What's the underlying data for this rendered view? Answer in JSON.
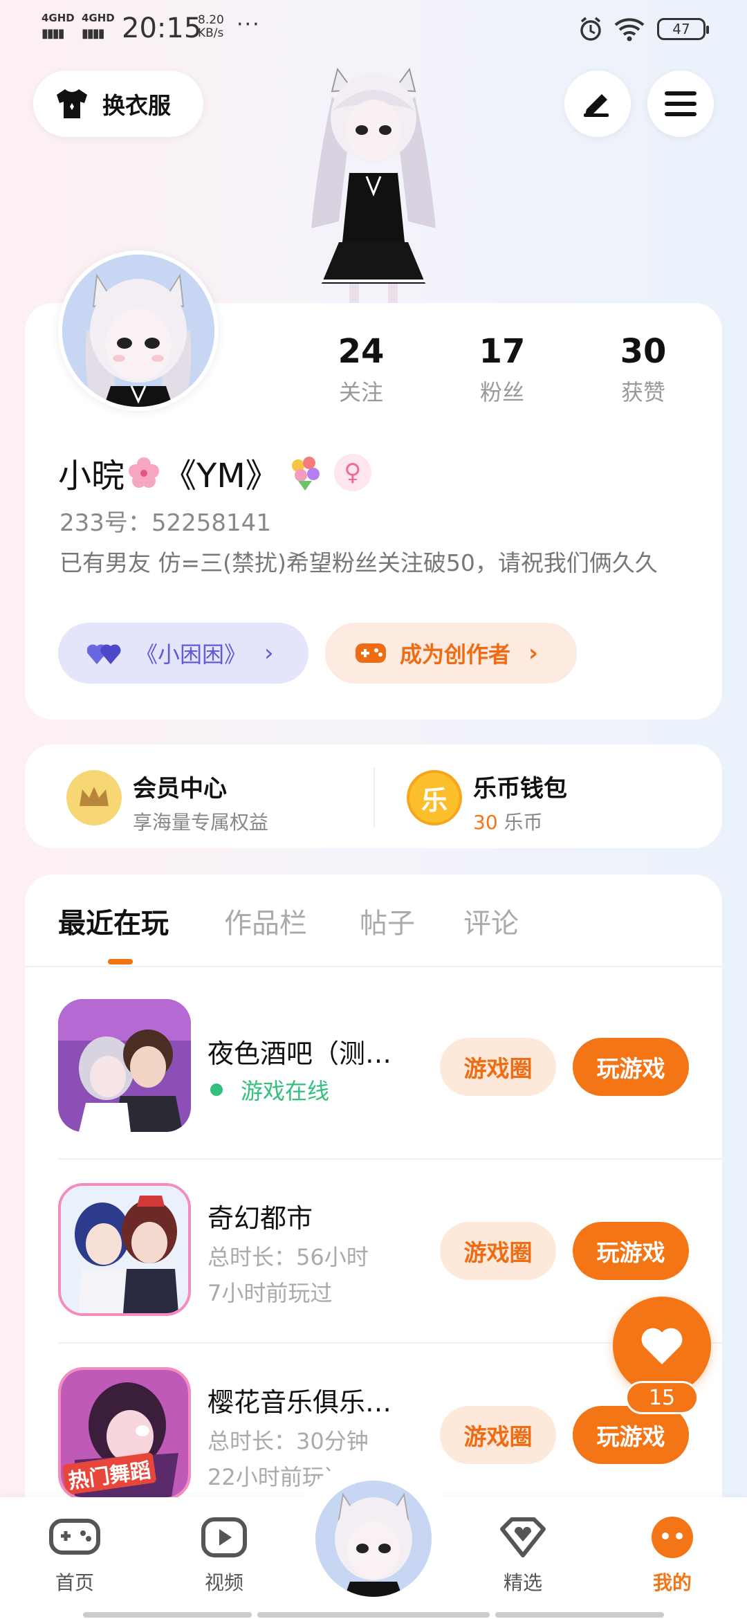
{
  "status_bar": {
    "network1": "4GHD",
    "network2": "4GHD",
    "time": "20:15",
    "speed_value": "8.20",
    "speed_unit": "KB/s",
    "more": "···",
    "battery": "47"
  },
  "header": {
    "outfit_label": "换衣服",
    "edit_icon": "pen-icon",
    "menu_icon": "menu-icon"
  },
  "profile": {
    "stats": [
      {
        "num": "24",
        "label": "关注"
      },
      {
        "num": "17",
        "label": "粉丝"
      },
      {
        "num": "30",
        "label": "获赞"
      }
    ],
    "name_prefix": "小晥",
    "name_suffix": "《YM》",
    "uid": "233号：52258141",
    "bio": "已有男友 仿=三(禁扰)希望粉丝关注破50，请祝我们俩久久",
    "couple_label": "《小困困》",
    "creator_label": "成为创作者"
  },
  "membership": {
    "vip_title": "会员中心",
    "vip_sub": "享海量专属权益",
    "wallet_title": "乐币钱包",
    "wallet_amount": "30",
    "wallet_unit": "乐币",
    "coin_char": "乐"
  },
  "tabs": [
    "最近在玩",
    "作品栏",
    "帖子",
    "评论"
  ],
  "games": [
    {
      "name": "夜色酒吧（测…",
      "status": "游戏在线",
      "circle_label": "游戏圈",
      "play_label": "玩游戏"
    },
    {
      "name": "奇幻都市",
      "duration": "总时长：56小时",
      "last_played": "7小时前玩过",
      "circle_label": "游戏圈",
      "play_label": "玩游戏"
    },
    {
      "name": "樱花音乐俱乐…",
      "duration": "总时长：30分钟",
      "last_played": "22小时前玩过",
      "circle_label": "游戏圈",
      "play_label": "玩游戏",
      "thumb_badge": "热门舞蹈"
    }
  ],
  "fab": {
    "count": "15"
  },
  "bottom_nav": [
    {
      "label": "首页",
      "icon": "gamepad-icon"
    },
    {
      "label": "视频",
      "icon": "video-icon"
    },
    {
      "label": "",
      "icon": "avatar"
    },
    {
      "label": "精选",
      "icon": "heart-diamond-icon"
    },
    {
      "label": "我的",
      "icon": "profile-icon"
    }
  ],
  "colors": {
    "accent": "#f47516",
    "online": "#33c07f",
    "couple": "#5d5bd6"
  }
}
